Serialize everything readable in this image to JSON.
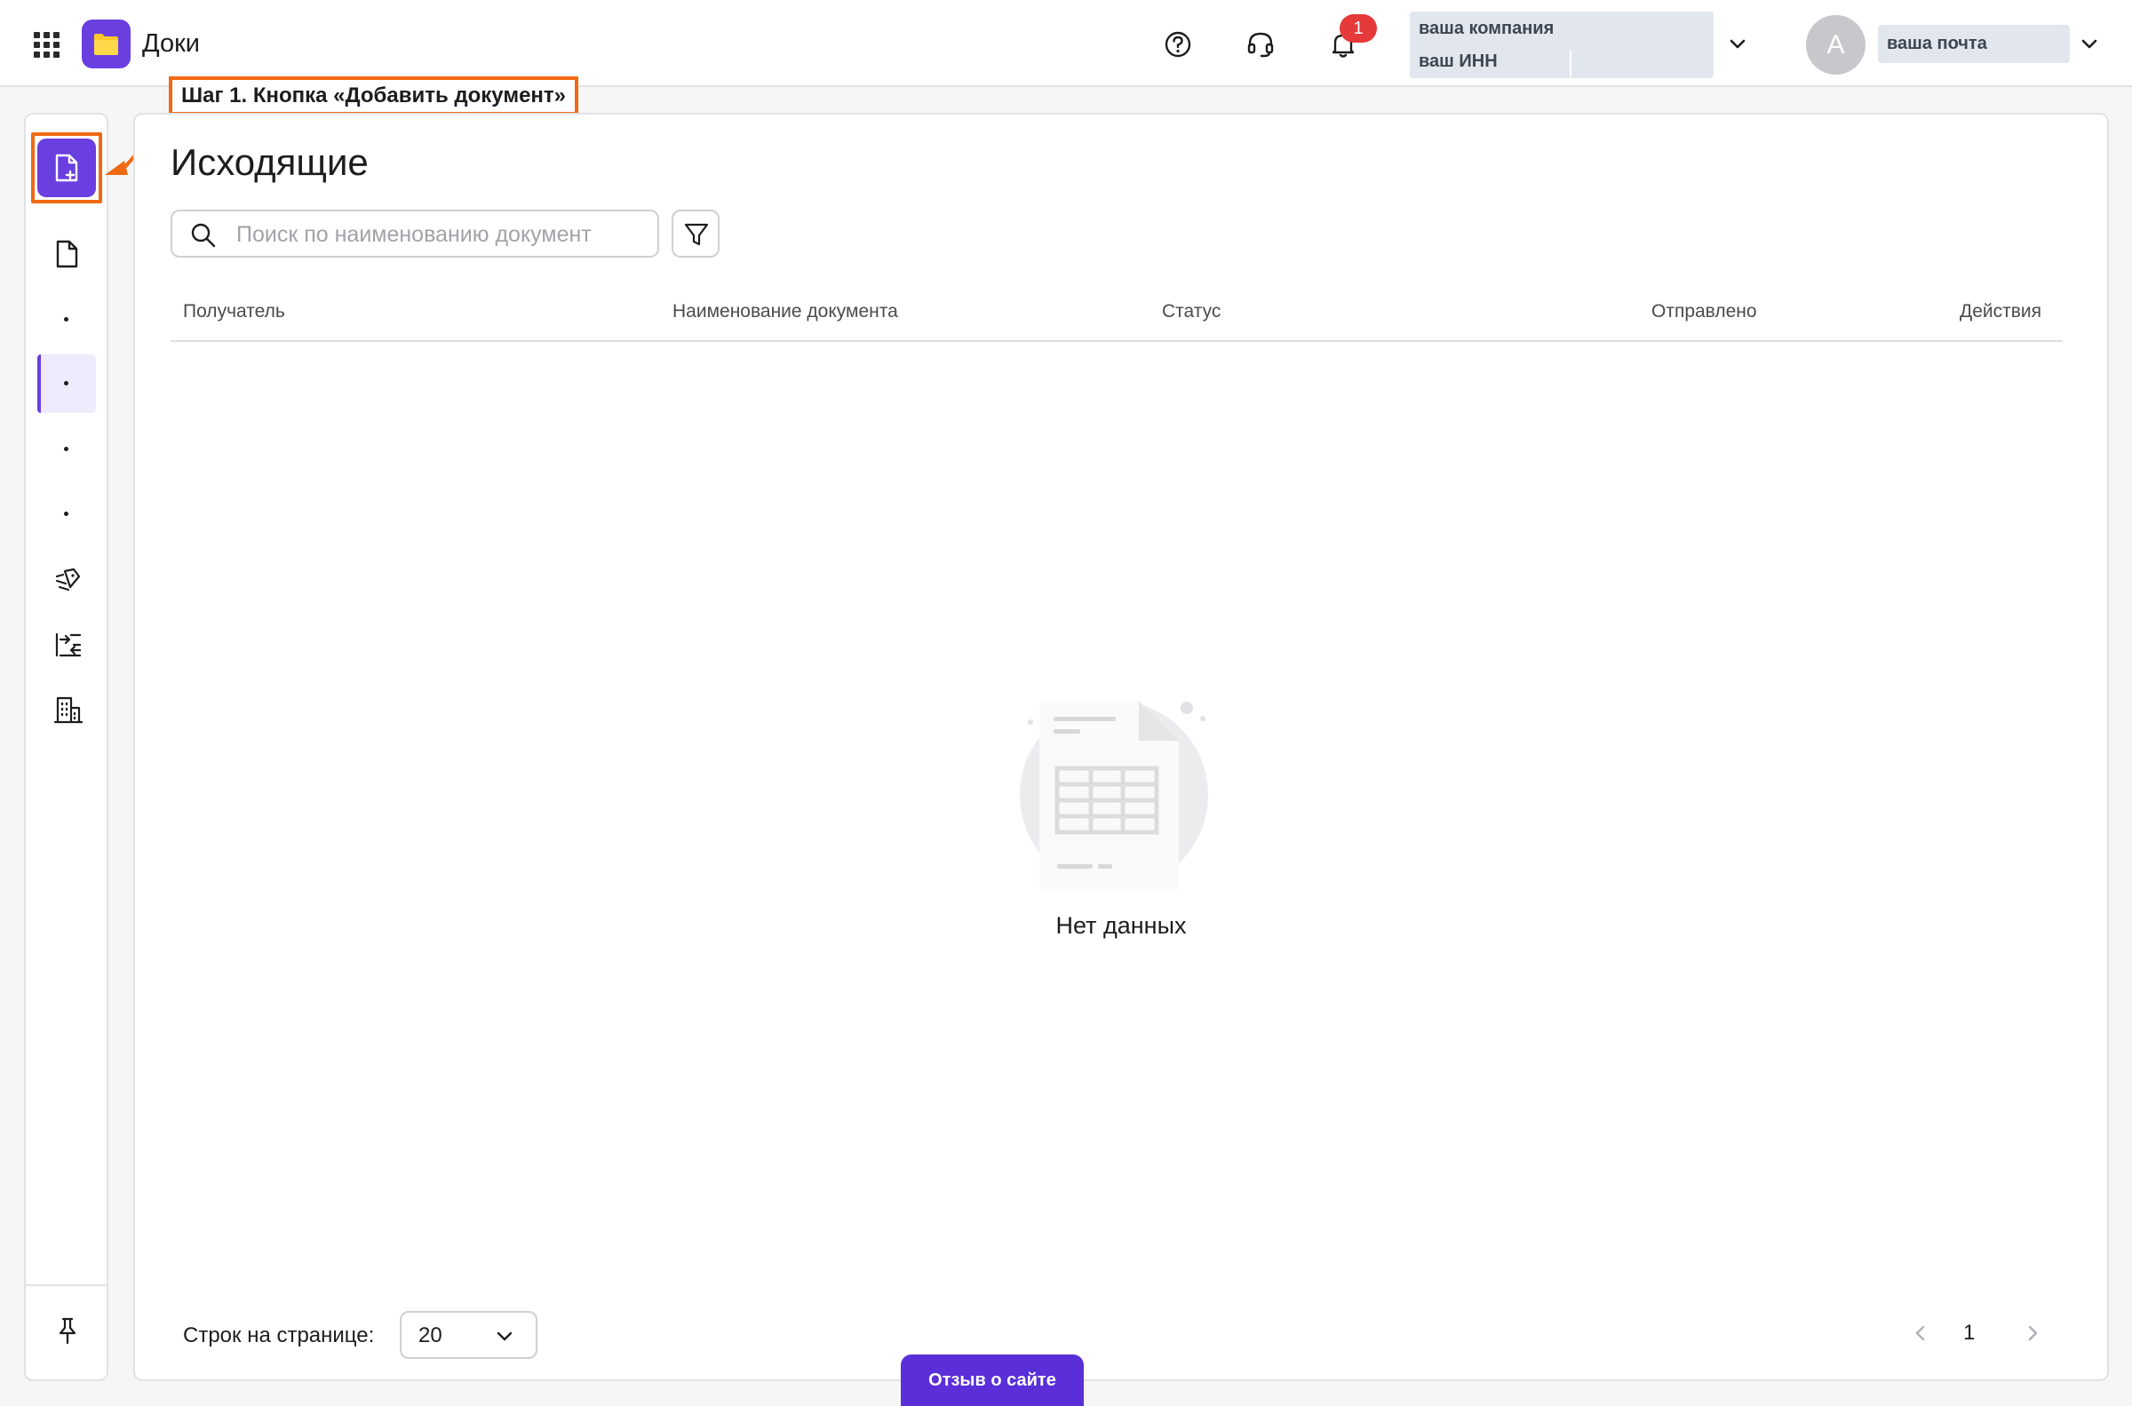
{
  "header": {
    "app_title": "Доки",
    "notification_count": "1",
    "company_name": "ваша компания",
    "company_inn": "ваш ИНН",
    "avatar_letter": "A",
    "user_email": "ваша почта"
  },
  "callout": {
    "text": "Шаг 1. Кнопка «Добавить документ»"
  },
  "main": {
    "title": "Исходящие",
    "search_placeholder": "Поиск по наименованию документа",
    "columns": [
      "Получатель",
      "Наименование документа",
      "Статус",
      "Отправлено",
      "Действия"
    ],
    "empty_text": "Нет данных",
    "rows_per_page_label": "Строк на странице:",
    "rows_per_page_value": "20",
    "current_page": "1"
  },
  "feedback": {
    "label": "Отзыв о сайте"
  },
  "colors": {
    "brand": "#6a3fe0",
    "highlight": "#ef6a12",
    "badge": "#e5393a"
  },
  "icons": {
    "apps": "apps-grid-icon",
    "logo": "folder-icon",
    "help": "help-circle-icon",
    "support": "headset-icon",
    "notifications": "bell-icon",
    "add_document": "file-plus-icon",
    "documents": "file-icon",
    "sign": "pen-sign-icon",
    "exchange": "exchange-icon",
    "organization": "building-icon",
    "pin": "pin-icon",
    "search": "search-icon",
    "filter": "filter-icon"
  }
}
